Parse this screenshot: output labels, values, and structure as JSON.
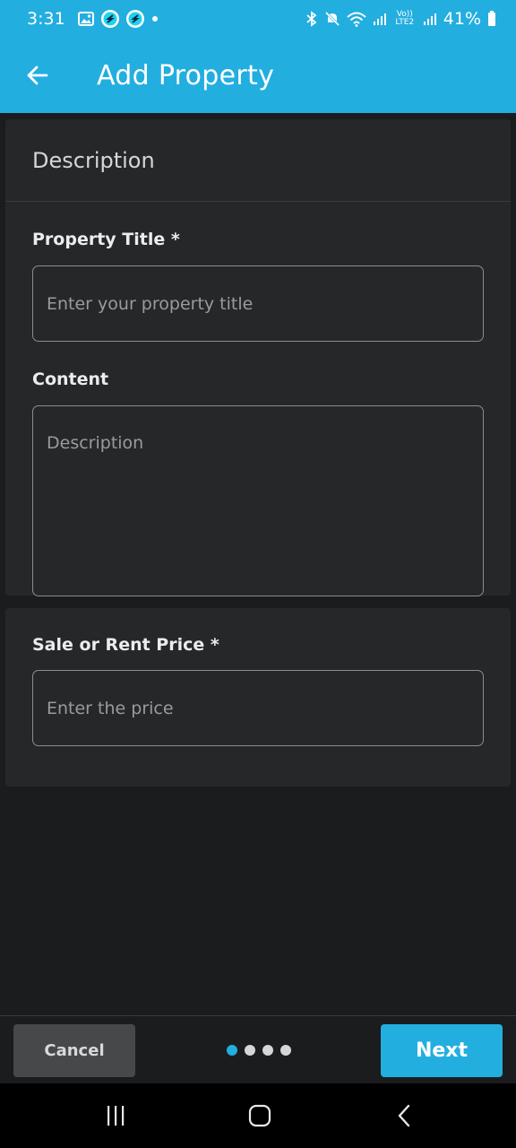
{
  "status_bar": {
    "time": "3:31",
    "battery": "41%",
    "left_icons": [
      "image-icon",
      "app-s-icon",
      "app-s-icon",
      "notification-dot-icon"
    ],
    "right_icons": [
      "bluetooth-icon",
      "mute-icon",
      "wifi-icon",
      "signal-icon",
      "volte-icon",
      "signal-icon",
      "battery-icon"
    ],
    "volte": "Vo)) LTE2"
  },
  "app_bar": {
    "title": "Add Property",
    "back_icon": "arrow-left-icon"
  },
  "description_card": {
    "header": "Description",
    "title_label": "Property Title *",
    "title_placeholder": "Enter your property title",
    "content_label": "Content",
    "content_placeholder": "Description"
  },
  "price_card": {
    "price_label": "Sale or Rent Price *",
    "price_placeholder": "Enter the price"
  },
  "bottom_bar": {
    "cancel_label": "Cancel",
    "next_label": "Next",
    "steps_total": 4,
    "current_step": 1
  },
  "colors": {
    "accent": "#23aee0",
    "background": "#1b1c1e",
    "card": "#262729",
    "cancel": "#47484a"
  },
  "system_nav": [
    "recent-apps-icon",
    "home-icon",
    "back-icon"
  ]
}
